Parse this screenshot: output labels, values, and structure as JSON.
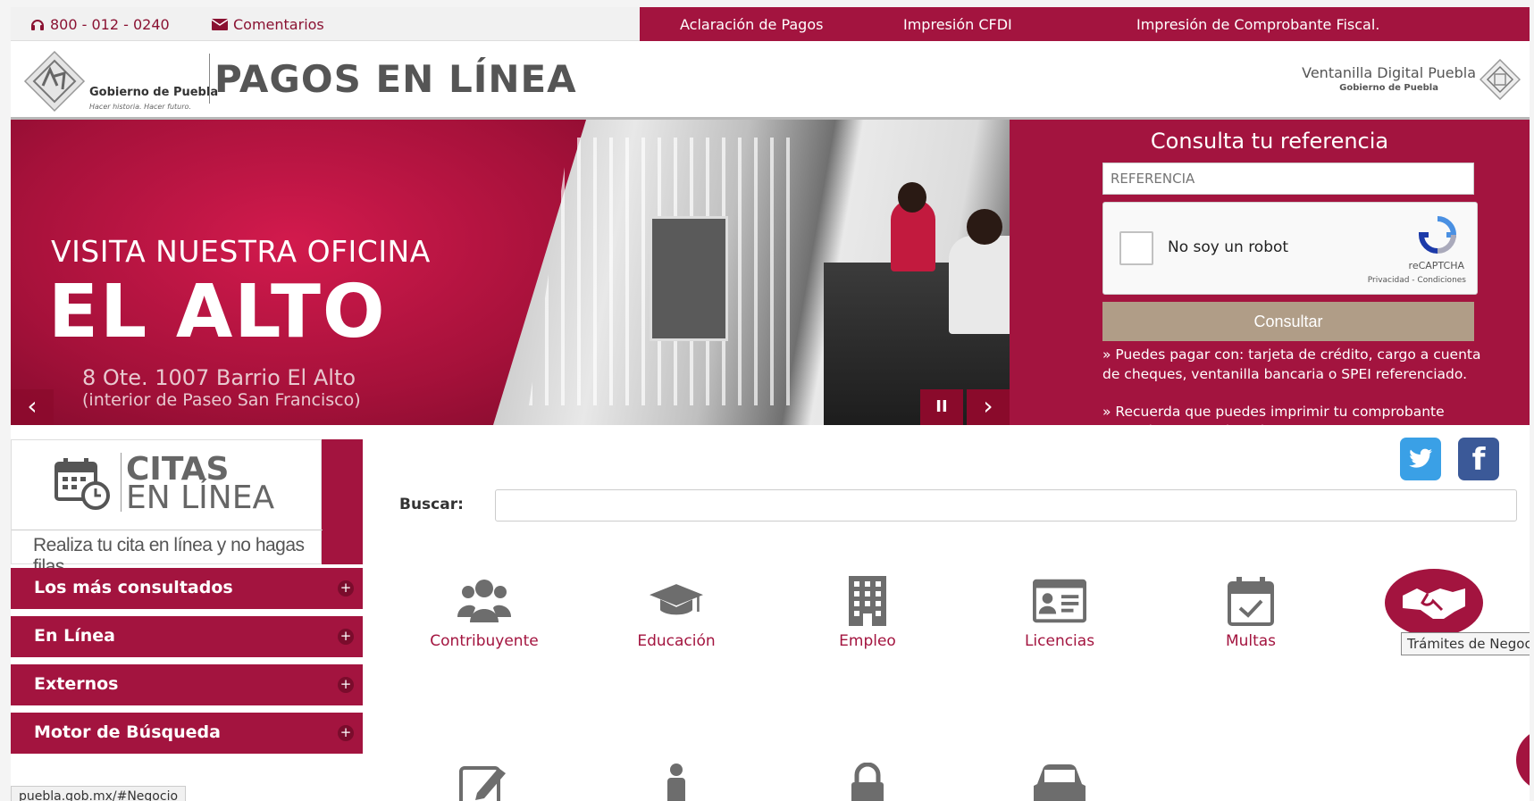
{
  "topbar": {
    "phone": "800 - 012 - 0240",
    "comments": "Comentarios",
    "links": [
      "Aclaración de Pagos",
      "Impresión CFDI",
      "Impresión de Comprobante Fiscal."
    ]
  },
  "header": {
    "gov_name": "Gobierno de Puebla",
    "gov_slogan": "Hacer historia. Hacer futuro.",
    "title": "PAGOS EN LÍNEA",
    "ventanilla": "Ventanilla Digital Puebla",
    "ventanilla_sub": "Gobierno de Puebla"
  },
  "slider": {
    "line1": "VISITA NUESTRA OFICINA",
    "line2": "EL ALTO",
    "line3": "8 Ote. 1007 Barrio El Alto",
    "line4": "(interior de Paseo San Francisco)",
    "prev": "‹",
    "pause": "II",
    "next": "›"
  },
  "consulta": {
    "title": "Consulta tu referencia",
    "input_placeholder": "REFERENCIA",
    "recaptcha_text": "No soy un robot",
    "recaptcha_brand": "reCAPTCHA",
    "recaptcha_links": "Privacidad - Condiciones",
    "button": "Consultar",
    "note1": "» Puedes pagar con: tarjeta de crédito, cargo a cuenta de cheques, ventanilla bancaria o SPEI referenciado.",
    "note2": "» Recuerda que puedes imprimir tu comprobante después de dos días hábiles."
  },
  "citas": {
    "title1": "CITAS",
    "title2": "EN LÍNEA",
    "subtitle": "Realiza tu cita en línea y no hagas filas"
  },
  "accordion": [
    {
      "label": "Los más consultados"
    },
    {
      "label": "En Línea"
    },
    {
      "label": "Externos"
    },
    {
      "label": "Motor de Búsqueda"
    }
  ],
  "search": {
    "label": "Buscar:"
  },
  "categories": [
    {
      "label": "Contribuyente",
      "icon": "users-icon"
    },
    {
      "label": "Educación",
      "icon": "graduation-cap-icon"
    },
    {
      "label": "Empleo",
      "icon": "building-icon"
    },
    {
      "label": "Licencias",
      "icon": "id-card-icon"
    },
    {
      "label": "Multas",
      "icon": "calendar-check-icon"
    },
    {
      "label": "Trámites de Negocio",
      "icon": "handshake-icon"
    }
  ],
  "tooltip": "Trámites de Negocio",
  "status_url": "puebla.gob.mx/#Negocio",
  "colors": {
    "brand": "#a3143f",
    "button": "#b09d87",
    "twitter": "#3aa0e6",
    "facebook": "#3b5998"
  }
}
